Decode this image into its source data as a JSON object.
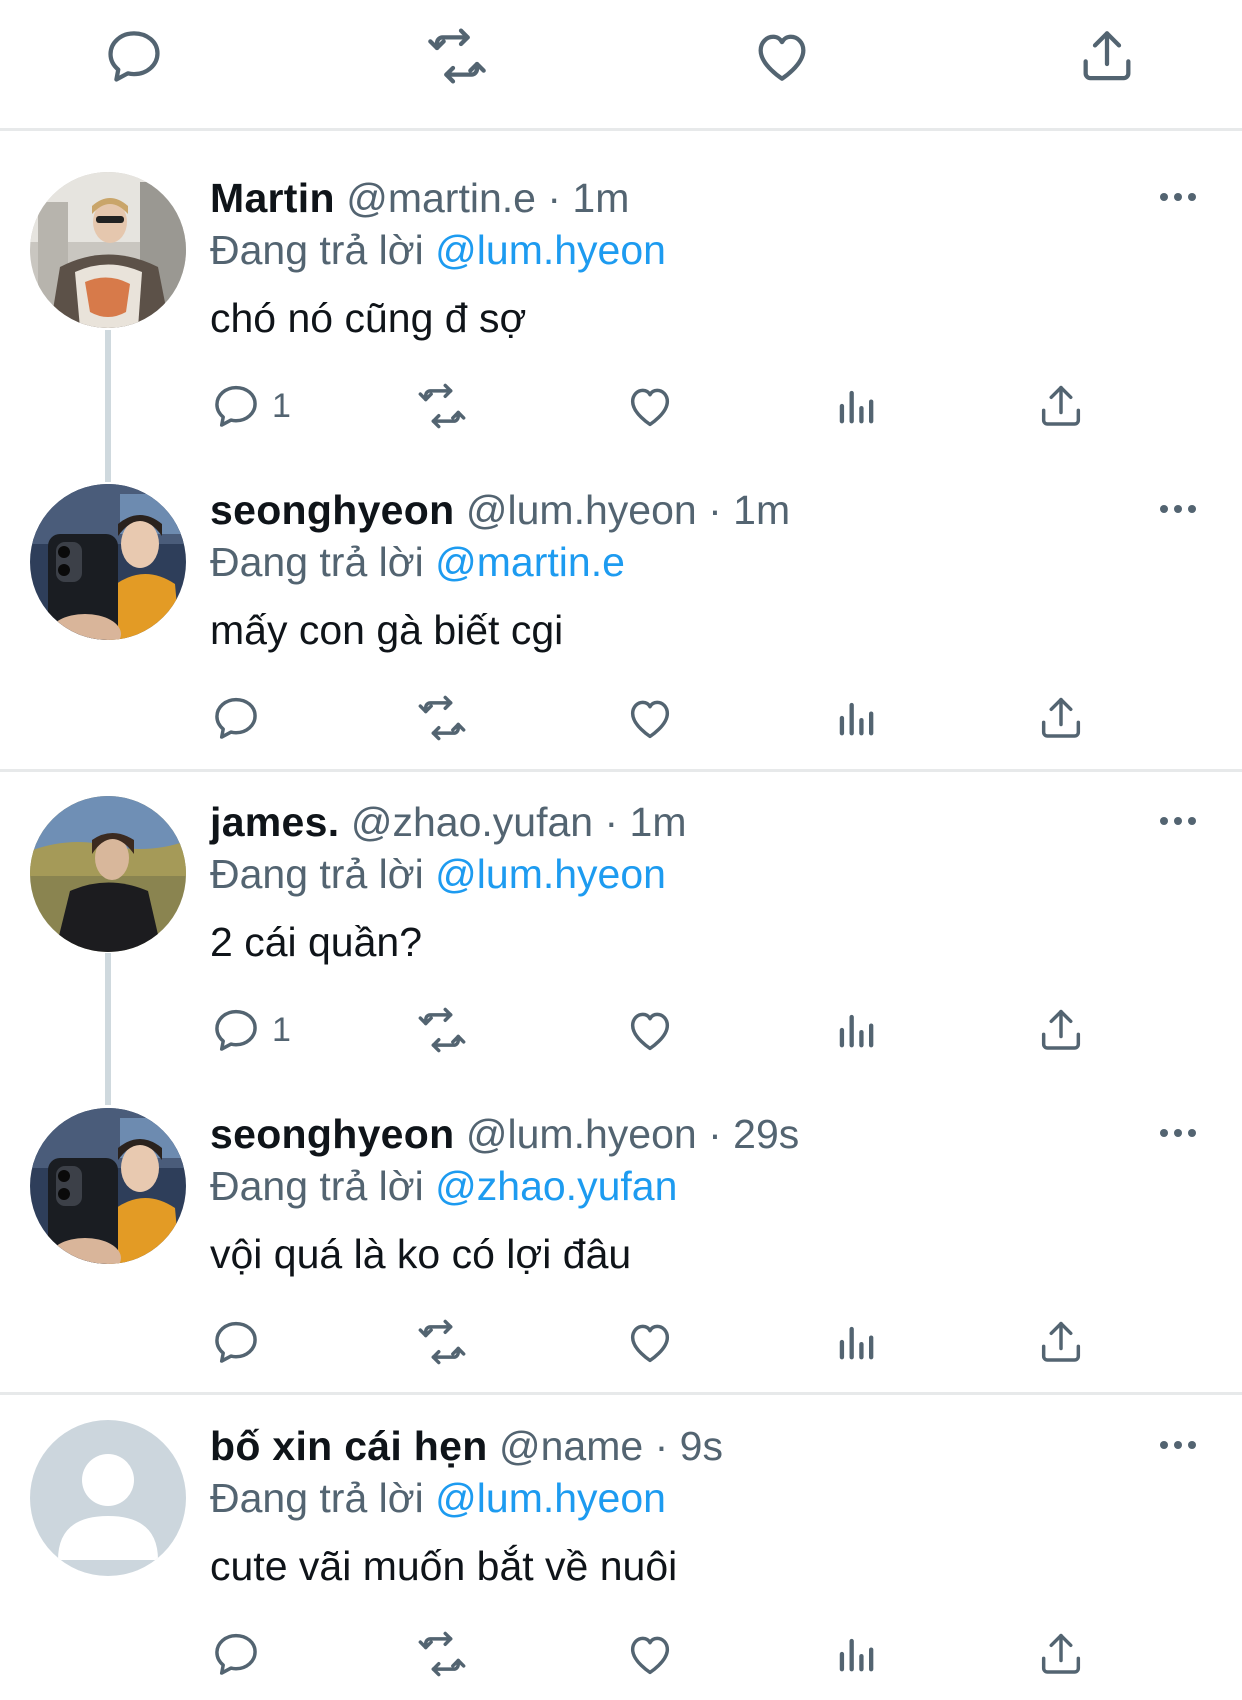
{
  "top_actions": [
    "reply-icon",
    "retweet-icon",
    "like-icon",
    "share-icon"
  ],
  "colors": {
    "accent": "#1d9bf0",
    "muted": "#536471",
    "divider": "#e7e9ea",
    "thread_line": "#cfd9de"
  },
  "replying_prefix": "Đang trả lời",
  "tweets": [
    {
      "name": "Martin",
      "handle": "@martin.e",
      "sep": "·",
      "time": "1m",
      "reply_to": "@lum.hyeon",
      "text": "chó nó cũng đ sợ",
      "reply_count": "1",
      "avatar": "avatar-photo"
    },
    {
      "name": "seonghyeon",
      "handle": "@lum.hyeon",
      "sep": "·",
      "time": "1m",
      "reply_to": "@martin.e",
      "text": "mấy con gà biết cgi",
      "reply_count": "",
      "avatar": "avatar-photo"
    },
    {
      "name": "james.",
      "handle": "@zhao.yufan",
      "sep": "·",
      "time": "1m",
      "reply_to": "@lum.hyeon",
      "text": "2 cái quần?",
      "reply_count": "1",
      "avatar": "avatar-photo"
    },
    {
      "name": "seonghyeon",
      "handle": "@lum.hyeon",
      "sep": "·",
      "time": "29s",
      "reply_to": "@zhao.yufan",
      "text": "vội quá là ko có lợi đâu",
      "reply_count": "",
      "avatar": "avatar-photo"
    },
    {
      "name": "bố xin cái hẹn",
      "handle": "@name",
      "sep": "·",
      "time": "9s",
      "reply_to": "@lum.hyeon",
      "text": "cute vãi muốn bắt về nuôi",
      "reply_count": "",
      "avatar": "default-avatar"
    }
  ]
}
